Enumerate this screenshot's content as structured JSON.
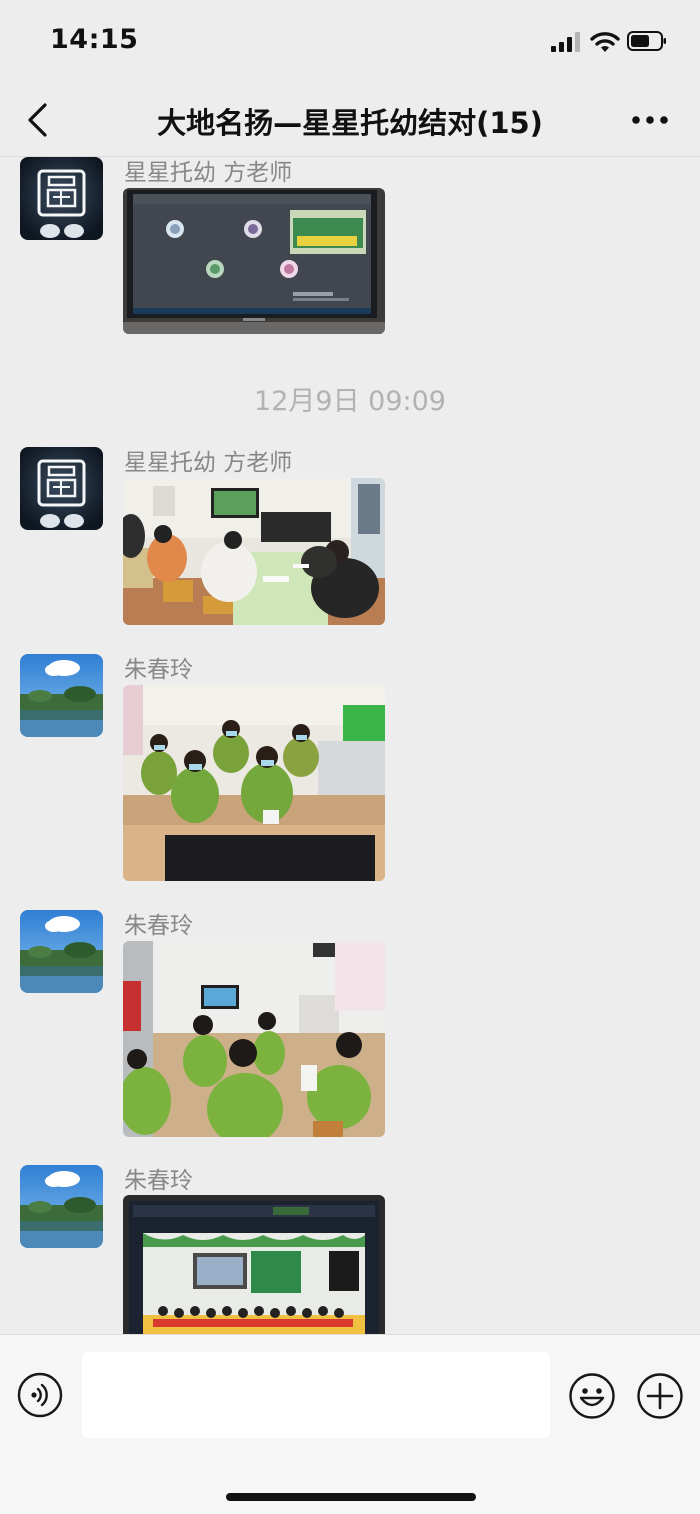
{
  "status_bar": {
    "time": "14:15"
  },
  "header": {
    "title": "大地名扬—星星托幼结对(15)"
  },
  "messages": [
    {
      "sender": "星星托幼 方老师",
      "avatar_icon": "round-seal-icon",
      "content": "photo-computer-video-call"
    },
    {
      "timestamp": "12月9日 09:09"
    },
    {
      "sender": "星星托幼 方老师",
      "avatar_icon": "round-seal-icon",
      "content": "photo-classroom-meeting"
    },
    {
      "sender": "朱春玲",
      "avatar_icon": "lake-landscape-icon",
      "content": "photo-teachers-seated"
    },
    {
      "sender": "朱春玲",
      "avatar_icon": "lake-landscape-icon",
      "content": "photo-teachers-watching-screen"
    },
    {
      "sender": "朱春玲",
      "avatar_icon": "lake-landscape-icon",
      "content": "photo-monitor-kindergarten-stage"
    }
  ],
  "input_bar": {
    "text_value": ""
  },
  "colors": {
    "background": "#ededed",
    "input_bar": "#f6f6f6",
    "text_primary": "#111111",
    "text_secondary": "#888888",
    "timestamp": "#b2b2b2"
  }
}
